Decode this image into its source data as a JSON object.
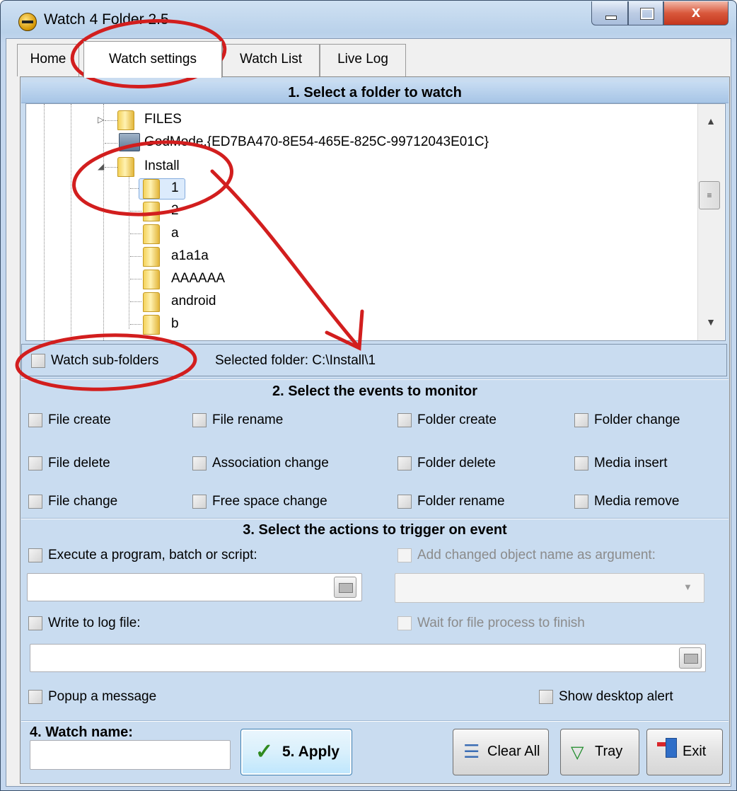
{
  "window": {
    "title": "Watch 4 Folder 2.5",
    "close_glyph": "x",
    "accent_color": "#d94d2c"
  },
  "tabs": [
    {
      "label": "Home"
    },
    {
      "label": "Watch settings",
      "selected": true
    },
    {
      "label": "Watch List"
    },
    {
      "label": "Live Log"
    }
  ],
  "section1": {
    "title": "1. Select a folder to watch",
    "tree": {
      "items": [
        {
          "label": "FILES",
          "icon": "folder-icon"
        },
        {
          "label": "GodMode.{ED7BA470-8E54-465E-825C-99712043E01C}",
          "icon": "control-panel-icon"
        },
        {
          "label": "Install",
          "icon": "folder-icon",
          "expanded": true
        },
        {
          "label": "1",
          "icon": "folder-icon",
          "selected": true
        },
        {
          "label": "2",
          "icon": "folder-icon"
        },
        {
          "label": "a",
          "icon": "folder-icon"
        },
        {
          "label": "a1a1a",
          "icon": "folder-icon"
        },
        {
          "label": "AAAAAA",
          "icon": "folder-icon"
        },
        {
          "label": "android",
          "icon": "folder-icon"
        },
        {
          "label": "b",
          "icon": "folder-icon"
        }
      ]
    },
    "watch_subfolders": {
      "label": "Watch sub-folders",
      "checked": false
    },
    "selected_folder": "Selected folder: C:\\Install\\1"
  },
  "section2": {
    "title": "2. Select the events to monitor",
    "events": {
      "file_create": "File create",
      "file_rename": "File rename",
      "folder_create": "Folder create",
      "folder_change": "Folder change",
      "file_delete": "File delete",
      "association_change": "Association change",
      "folder_delete": "Folder delete",
      "media_insert": "Media insert",
      "file_change": "File change",
      "free_space_change": "Free space change",
      "folder_rename": "Folder rename",
      "media_remove": "Media remove"
    }
  },
  "section3": {
    "title": "3. Select the actions to trigger on event",
    "execute_label": "Execute a program, batch or script:",
    "execute_value": "",
    "add_argument_label": "Add changed object name as argument:",
    "argument_combo_value": "",
    "write_log_label": "Write to log file:",
    "log_file_value": "",
    "wait_label": "Wait for file process to finish",
    "popup_label": "Popup a message",
    "desktop_alert_label": "Show desktop alert"
  },
  "section4": {
    "watch_name_label": "4. Watch name:",
    "watch_name_value": ""
  },
  "buttons": {
    "apply": "5. Apply",
    "clear_all": "Clear All",
    "tray": "Tray",
    "exit": "Exit"
  }
}
